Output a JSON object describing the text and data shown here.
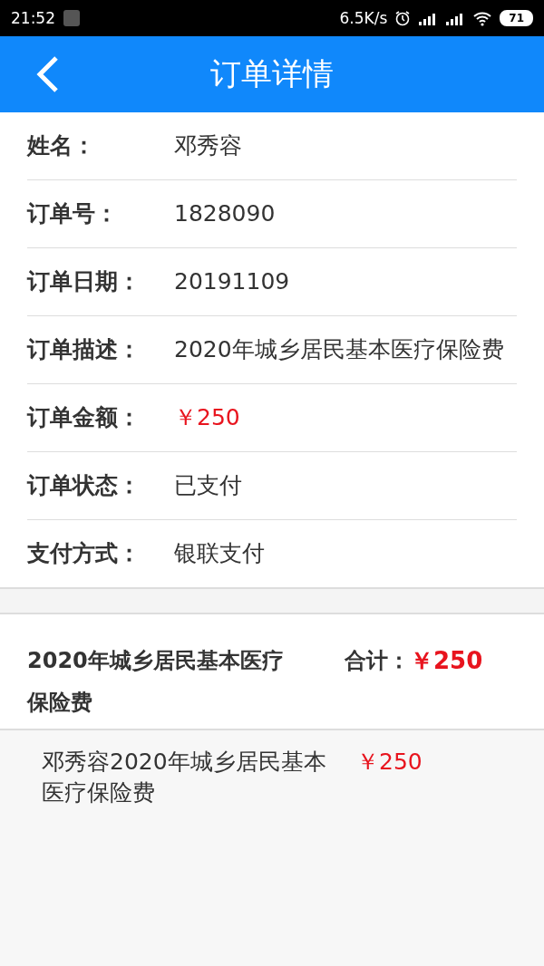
{
  "status_bar": {
    "time": "21:52",
    "speed": "6.5K/s",
    "battery": "71"
  },
  "header": {
    "title": "订单详情"
  },
  "fields": [
    {
      "label": "姓名：",
      "value": "邓秀容",
      "kind": "text"
    },
    {
      "label": "订单号：",
      "value": "1828090",
      "kind": "text"
    },
    {
      "label": "订单日期：",
      "value": "20191109",
      "kind": "text"
    },
    {
      "label": "订单描述：",
      "value": "2020年城乡居民基本医疗保险费",
      "kind": "text"
    },
    {
      "label": "订单金额：",
      "value": "￥250",
      "kind": "price"
    },
    {
      "label": "订单状态：",
      "value": "已支付",
      "kind": "text"
    },
    {
      "label": "支付方式：",
      "value": "银联支付",
      "kind": "text"
    }
  ],
  "summary": {
    "title": "2020年城乡居民基本医疗保险费",
    "total_label": "合计：",
    "total": "￥250"
  },
  "items": [
    {
      "name": "邓秀容2020年城乡居民基本医疗保险费",
      "price": "￥250"
    }
  ]
}
